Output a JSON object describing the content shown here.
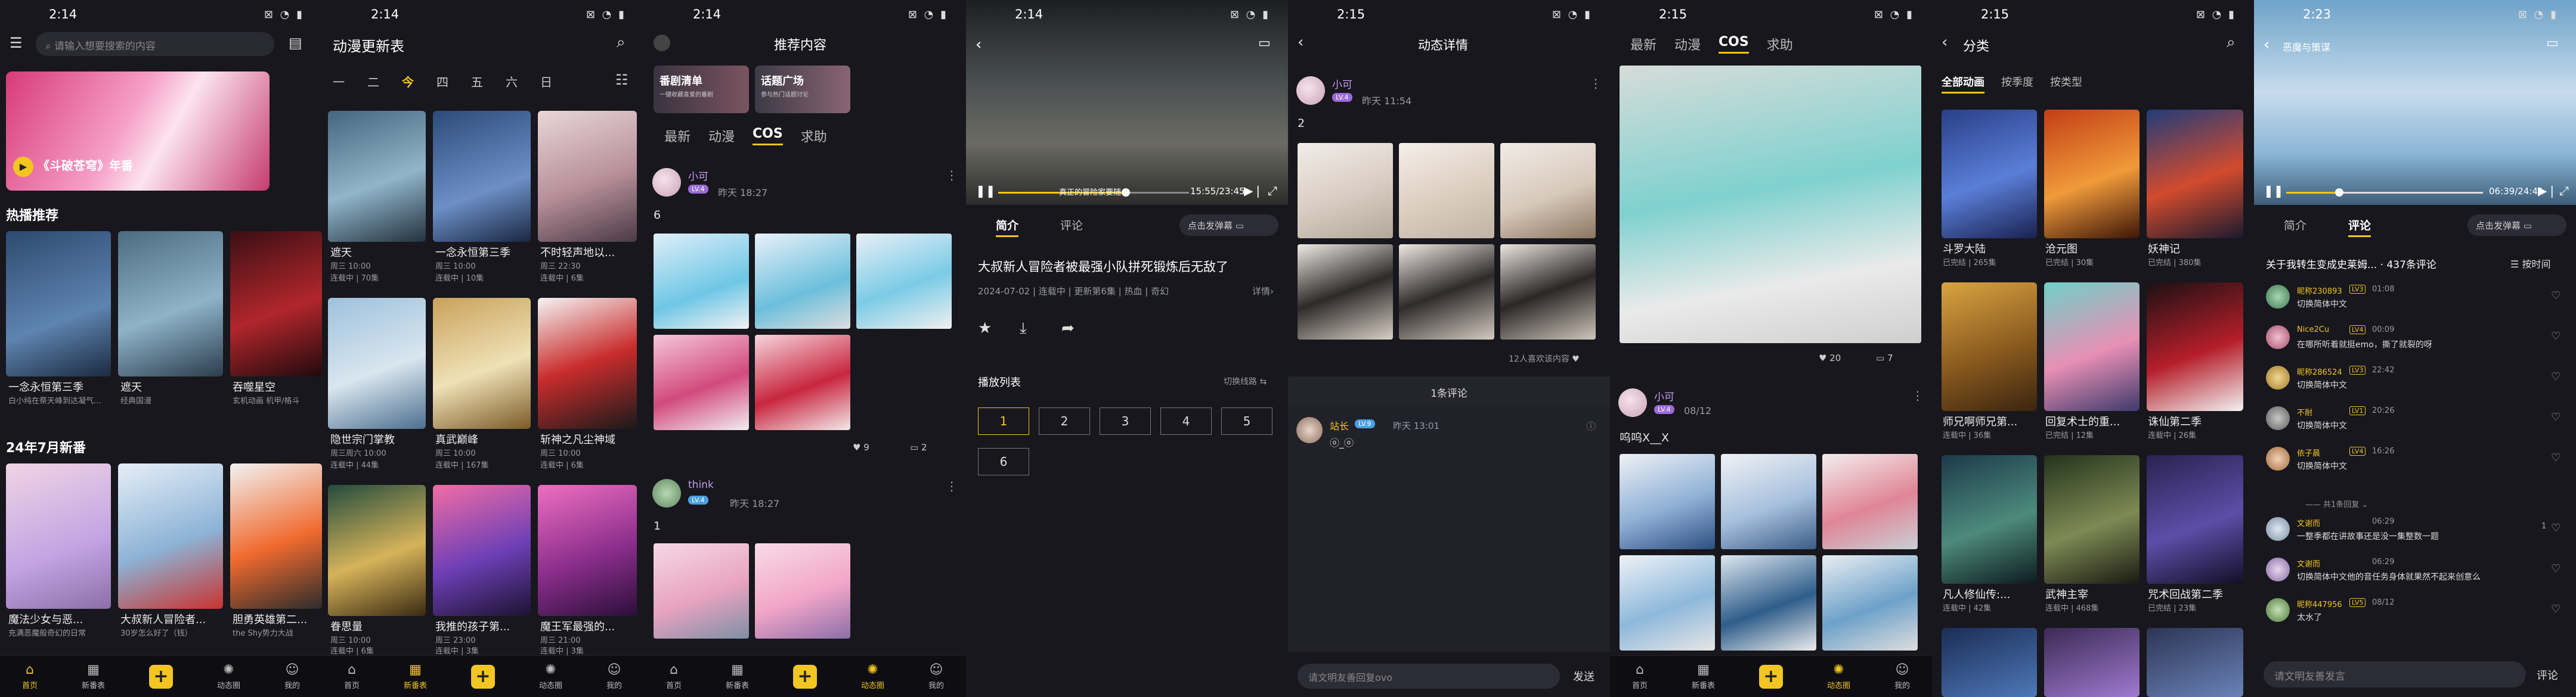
{
  "times": [
    "2:14",
    "2:14",
    "2:14",
    "2:14",
    "2:15",
    "2:15",
    "2:15",
    "2:23"
  ],
  "status_icons": "⊠ ◔ ▮",
  "nav": {
    "home": "首页",
    "schedule": "新番表",
    "feed": "动态圈",
    "mine": "我的"
  },
  "p1": {
    "search_placeholder": "请输入想要搜索的内容",
    "banner_title": "《斗破苍穹》年番",
    "hot_title": "热播推荐",
    "hot": [
      {
        "t": "一念永恒第三季",
        "s": "白小纯在祭天峰到达凝气..."
      },
      {
        "t": "遮天",
        "s": "经典国漫"
      },
      {
        "t": "吞噬星空",
        "s": "玄机动画 机甲/格斗"
      }
    ],
    "new_title": "24年7月新番",
    "new": [
      {
        "t": "魔法少女与恶...",
        "s": "充满恶魔般奇幻的日常"
      },
      {
        "t": "大叔新人冒险者...",
        "s": "30岁怎么好了（钱）"
      },
      {
        "t": "胆勇英雄第二...",
        "s": "the Shy势力大战"
      }
    ]
  },
  "p2": {
    "title": "动漫更新表",
    "days": [
      "一",
      "二",
      "今",
      "四",
      "五",
      "六",
      "日"
    ],
    "items": [
      {
        "t": "遮天",
        "s": "周三 10:00",
        "u": "连载中 | 70集"
      },
      {
        "t": "一念永恒第三季",
        "s": "周三 10:00",
        "u": "连载中 | 10集"
      },
      {
        "t": "不时轻声地以...",
        "s": "周三 22:30",
        "u": "连载中 | 6集"
      },
      {
        "t": "隐世宗门掌教",
        "s": "周三周六 10:00",
        "u": "连载中 | 44集"
      },
      {
        "t": "真武巅峰",
        "s": "周三 10:00",
        "u": "连载中 | 167集"
      },
      {
        "t": "斩神之凡尘神域",
        "s": "周三 10:00",
        "u": "连载中 | 6集"
      },
      {
        "t": "眷思量",
        "s": "周三 10:00",
        "u": "连载中 | 6集"
      },
      {
        "t": "我推的孩子第...",
        "s": "周三 23:00",
        "u": "连载中 | 3集"
      },
      {
        "t": "魔王军最强的...",
        "s": "周三 21:00",
        "u": "连载中 | 3集"
      }
    ]
  },
  "p3": {
    "title": "推荐内容",
    "chip1": "番剧清单",
    "chip1_sub": "一键收藏喜爱的番剧",
    "chip2": "话题广场",
    "chip2_sub": "参与热门话题讨论",
    "tabs": [
      "最新",
      "动漫",
      "COS",
      "求助"
    ],
    "post1": {
      "user": "小可",
      "lv": "LV.4",
      "time": "昨天 18:27",
      "text": "6",
      "likes": "9",
      "comments": "2"
    },
    "post2": {
      "user": "think",
      "lv": "LV.4",
      "time": "昨天 18:27",
      "text": "1"
    }
  },
  "p4": {
    "time": "15:55/23:45",
    "sub": "真正的冒险家要随...",
    "tabs": [
      "简介",
      "评论"
    ],
    "danmaku": "点击发弹幕",
    "title": "大叔新人冒险者被最强小队拼死锻炼后无敌了",
    "meta": "2024-07-02 | 连载中 | 更新第6集 | 热血 | 奇幻",
    "detail": "详情›",
    "playlist": "播放列表",
    "switch": "切换线路",
    "eps": [
      "1",
      "2",
      "3",
      "4",
      "5",
      "6"
    ]
  },
  "p5": {
    "title": "动态详情",
    "user": "小可",
    "lv": "LV.4",
    "time": "昨天 11:54",
    "text": "2",
    "likes_note": "12人喜欢该内容",
    "comment_count": "1条评论",
    "c_user": "站长",
    "c_lv": "LV.9",
    "c_time": "昨天 13:01",
    "c_text": "ⓞ_ⓞ",
    "input": "请文明友善回复ovo",
    "send": "发送"
  },
  "p6": {
    "tabs": [
      "最新",
      "动漫",
      "COS",
      "求助"
    ],
    "likes": "20",
    "comments": "7",
    "user": "小可",
    "time": "08/12",
    "text": "呜呜X__X"
  },
  "p7": {
    "title": "分类",
    "tabs": [
      "全部动画",
      "按季度",
      "按类型"
    ],
    "items": [
      {
        "t": "斗罗大陆",
        "s": "已完结 | 265集"
      },
      {
        "t": "沧元图",
        "s": "已完结 | 30集"
      },
      {
        "t": "妖神记",
        "s": "已完结 | 380集"
      },
      {
        "t": "师兄啊师兄第...",
        "s": "连载中 | 36集"
      },
      {
        "t": "回复术士的重...",
        "s": "已完结 | 12集"
      },
      {
        "t": "诛仙第二季",
        "s": "连载中 | 26集"
      },
      {
        "t": "凡人修仙传:...",
        "s": "连载中 | 42集"
      },
      {
        "t": "武神主宰",
        "s": "连载中 | 468集"
      },
      {
        "t": "咒术回战第二季",
        "s": "已完结 | 23集"
      }
    ]
  },
  "p8": {
    "title": "恶魔与策谋",
    "time": "06:39/24:41",
    "tabs": [
      "简介",
      "评论"
    ],
    "danmaku": "点击发弹幕",
    "topic": "关于我转生变成史莱姆...",
    "count": "437条评论",
    "sort": "按时间",
    "comments": [
      {
        "u": "昵称230893",
        "l": "LV3",
        "tm": "01:08",
        "x": "切换简体中文",
        "n": ""
      },
      {
        "u": "Nice2Cu",
        "l": "LV4",
        "tm": "00:09",
        "x": "在哪所听着就挺emo，撕了就裂的呀",
        "n": ""
      },
      {
        "u": "昵称286524",
        "l": "LV3",
        "tm": "22:42",
        "x": "切换简体中文",
        "n": ""
      },
      {
        "u": "不耐",
        "l": "LV1",
        "tm": "20:26",
        "x": "切换简体中文",
        "n": ""
      },
      {
        "u": "依子晨",
        "l": "LV4",
        "tm": "16:26",
        "x": "切换简体中文",
        "n": ""
      },
      {
        "u": "文谢而",
        "l": "",
        "tm": "06:29",
        "x": "一整季都在讲故事还是没一集整数一题",
        "n": "1"
      },
      {
        "u": "文谢而",
        "l": "",
        "tm": "06:29",
        "x": "切换简体中文他的音任务身体就果然不起来创意么",
        "n": ""
      },
      {
        "u": "昵称447956",
        "l": "LV5",
        "tm": "08/12",
        "x": "太水了",
        "n": ""
      }
    ],
    "reply_toggle": "—— 共1条回复 ⌄",
    "input": "请文明友善发言",
    "send": "评论"
  },
  "colors": {
    "accent": "#f3c522",
    "bg": "#17171d",
    "nav": "#0e0e12"
  }
}
